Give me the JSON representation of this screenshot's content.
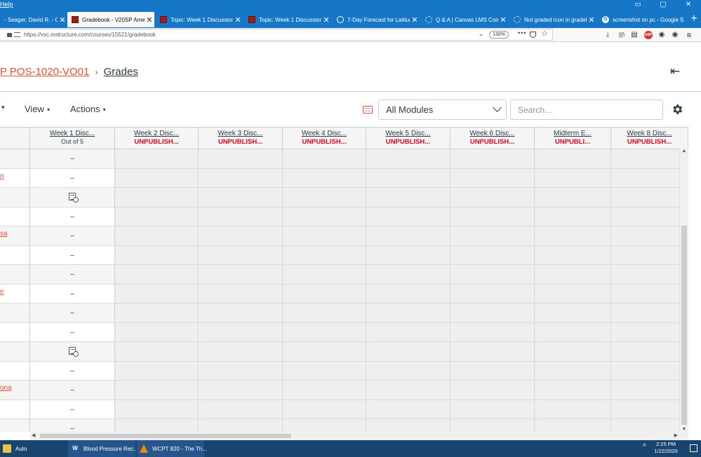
{
  "window": {
    "menu_label": "Help",
    "minimize": "▭",
    "maximize": "▢",
    "close": "✕"
  },
  "tabs": [
    {
      "label": "- Seager, David R. - Ou",
      "active": false,
      "favicon": "none"
    },
    {
      "label": "Gradebook - V20SP Amer P",
      "active": true,
      "favicon": "canvas"
    },
    {
      "label": "Topic: Week 1 Discussion",
      "active": false,
      "favicon": "canvas"
    },
    {
      "label": "Topic: Week 1 Discussion",
      "active": false,
      "favicon": "canvas"
    },
    {
      "label": "7-Day Forecast for Latitude",
      "active": false,
      "favicon": "weather"
    },
    {
      "label": "Q & A | Canvas LMS Comm",
      "active": false,
      "favicon": "community"
    },
    {
      "label": "Not graded icon in gradebo",
      "active": false,
      "favicon": "community"
    },
    {
      "label": "screenshot on pc - Google S",
      "active": false,
      "favicon": "google"
    }
  ],
  "tab_close": "✕",
  "new_tab": "+",
  "navbar": {
    "url": "https://vsc.instructure.com/courses/15521/gradebook",
    "zoom": "130%",
    "more": "•••",
    "dropdown": "⌄",
    "star": "☆",
    "download": "⤓",
    "library": "|||\\",
    "sidebar": "▤",
    "abp": "ABP",
    "account": "◉",
    "menu": "≡"
  },
  "page": {
    "course": "P POS-1020-VO01",
    "separator": "›",
    "current": "Grades",
    "collapse": "⇤"
  },
  "toolbar": {
    "caret": "▾",
    "view": "View",
    "actions": "Actions",
    "menu_caret": "▾",
    "modules_selected": "All Modules",
    "search_placeholder": "Search..."
  },
  "grid": {
    "columns": [
      {
        "title": "Week 1 Disc...",
        "sub": "Out of 5",
        "unpublished": false
      },
      {
        "title": "Week 2 Disc...",
        "sub": "UNPUBLISH...",
        "unpublished": true
      },
      {
        "title": "Week 3 Disc...",
        "sub": "UNPUBLISH...",
        "unpublished": true
      },
      {
        "title": "Week 4 Disc...",
        "sub": "UNPUBLISH...",
        "unpublished": true
      },
      {
        "title": "Week 5 Disc...",
        "sub": "UNPUBLISH...",
        "unpublished": true
      },
      {
        "title": "Week 6 Disc...",
        "sub": "UNPUBLISH...",
        "unpublished": true
      },
      {
        "title": "Midterm E...",
        "sub": "UNPUBLI...",
        "unpublished": true
      },
      {
        "title": "Week 8 Disc...",
        "sub": "UNPUBLISH...",
        "unpublished": true
      }
    ],
    "rows": [
      {
        "name": "",
        "value": "–",
        "icon": false
      },
      {
        "name": "n",
        "value": "–",
        "icon": false
      },
      {
        "name": "",
        "value": "",
        "icon": true
      },
      {
        "name": "",
        "value": "–",
        "icon": false
      },
      {
        "name": "sa",
        "value": "–",
        "icon": false
      },
      {
        "name": "",
        "value": "–",
        "icon": false
      },
      {
        "name": "",
        "value": "–",
        "icon": false
      },
      {
        "name": "e",
        "value": "–",
        "icon": false
      },
      {
        "name": "",
        "value": "–",
        "icon": false
      },
      {
        "name": "",
        "value": "–",
        "icon": false
      },
      {
        "name": "",
        "value": "",
        "icon": true
      },
      {
        "name": "",
        "value": "–",
        "icon": false
      },
      {
        "name": "ona",
        "value": "–",
        "icon": false
      },
      {
        "name": "",
        "value": "–",
        "icon": false
      },
      {
        "name": "",
        "value": "–",
        "icon": false
      }
    ]
  },
  "scroll": {
    "up": "▲",
    "down": "▼",
    "left": "◀",
    "right": "▶"
  },
  "taskbar": {
    "items": [
      {
        "label": "Auto",
        "icon": "folder"
      },
      {
        "label": "Blood Pressure Rec...",
        "icon": "word"
      },
      {
        "label": "WCPT 820 - The Th...",
        "icon": "vlc"
      }
    ],
    "tray_arrow": "^",
    "time": "2:25 PM",
    "date": "1/22/2020"
  },
  "colors": {
    "accent": "#e0532f",
    "unpublished": "#e0061f",
    "taskbar": "#1a4470",
    "tabbar": "#1677c9"
  }
}
